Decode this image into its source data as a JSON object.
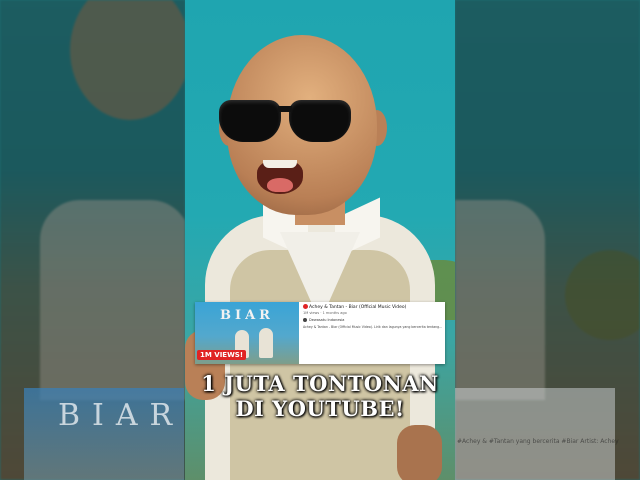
{
  "scene": {
    "accent_red": "#e02424",
    "sky_color": "#1fa5b0"
  },
  "video_card": {
    "thumbnail_title": "BIAR",
    "badge": "1M VIEWS!",
    "title": "Achey & Tantan - Biar (Official Music Video)",
    "meta": "1M views · 1 months ago",
    "channel": "Dewasatu Indonesia",
    "description": "Achey & Tantan - Biar (Official Music Video). Lirik dan lagunya yang bercerita tentang..."
  },
  "caption": {
    "line1": "1 JUTA TONTONAN",
    "line2": "DI YOUTUBE!"
  },
  "background": {
    "left_card_title": "BIAR",
    "right_text": "#Achey & #Tantan yang bercerita #Biar Artist: Achey"
  }
}
